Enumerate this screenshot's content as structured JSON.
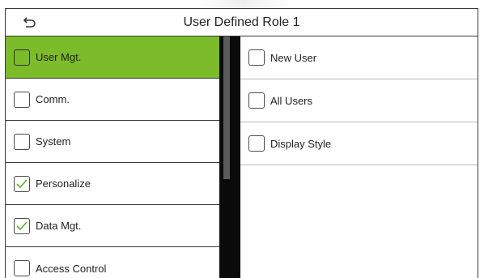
{
  "header": {
    "title": "User Defined Role 1",
    "back_icon": "back-arrow-icon"
  },
  "left_menu": {
    "items": [
      {
        "label": "User Mgt.",
        "checked": false,
        "active": true
      },
      {
        "label": "Comm.",
        "checked": false,
        "active": false
      },
      {
        "label": "System",
        "checked": false,
        "active": false
      },
      {
        "label": "Personalize",
        "checked": true,
        "active": false
      },
      {
        "label": "Data Mgt.",
        "checked": true,
        "active": false
      },
      {
        "label": "Access Control",
        "checked": false,
        "active": false
      }
    ]
  },
  "right_menu": {
    "items": [
      {
        "label": "New User",
        "checked": false
      },
      {
        "label": "All Users",
        "checked": false
      },
      {
        "label": "Display Style",
        "checked": false
      }
    ]
  },
  "colors": {
    "active_item": "#7cbb2a",
    "check_mark": "#56b22a",
    "scroll_track": "#0a0a0a",
    "scroll_thumb": "#5b5b5b"
  }
}
